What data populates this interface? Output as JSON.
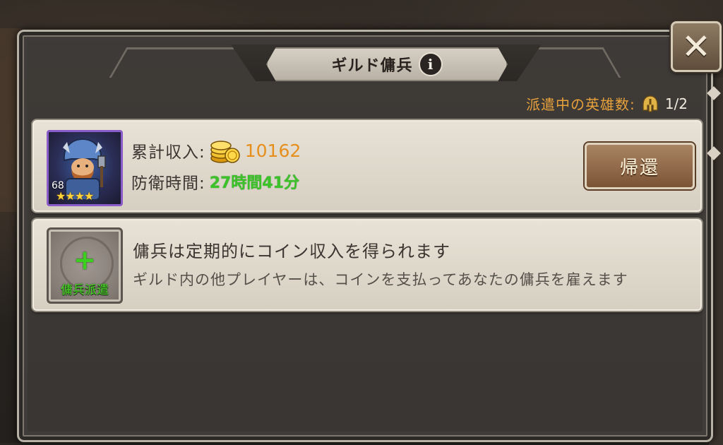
{
  "dialog": {
    "title": "ギルド傭兵",
    "info_icon": "i",
    "close_icon": "✕"
  },
  "deploy_count": {
    "label": "派遣中の英雄数:",
    "value": "1/2",
    "icon": "helmet-icon"
  },
  "hero_card": {
    "hero_level": "68",
    "hero_stars": "★★★★",
    "star_count": 4,
    "income_label": "累計収入:",
    "income_value": "10162",
    "income_icon": "gold-coins-icon",
    "defense_label": "防衛時間:",
    "defense_value": "27時間41分",
    "return_button": "帰還"
  },
  "info_card": {
    "plus_icon": "+",
    "slot_label": "傭兵派遣",
    "line1": "傭兵は定期的にコイン収入を得られます",
    "line2": "ギルド内の他プレイヤーは、コインを支払ってあなたの傭兵を雇えます"
  },
  "colors": {
    "accent_orange": "#e8a23c",
    "income_orange": "#e68f1c",
    "time_green": "#3cc32a",
    "portrait_border_purple": "#8a5cc9"
  }
}
